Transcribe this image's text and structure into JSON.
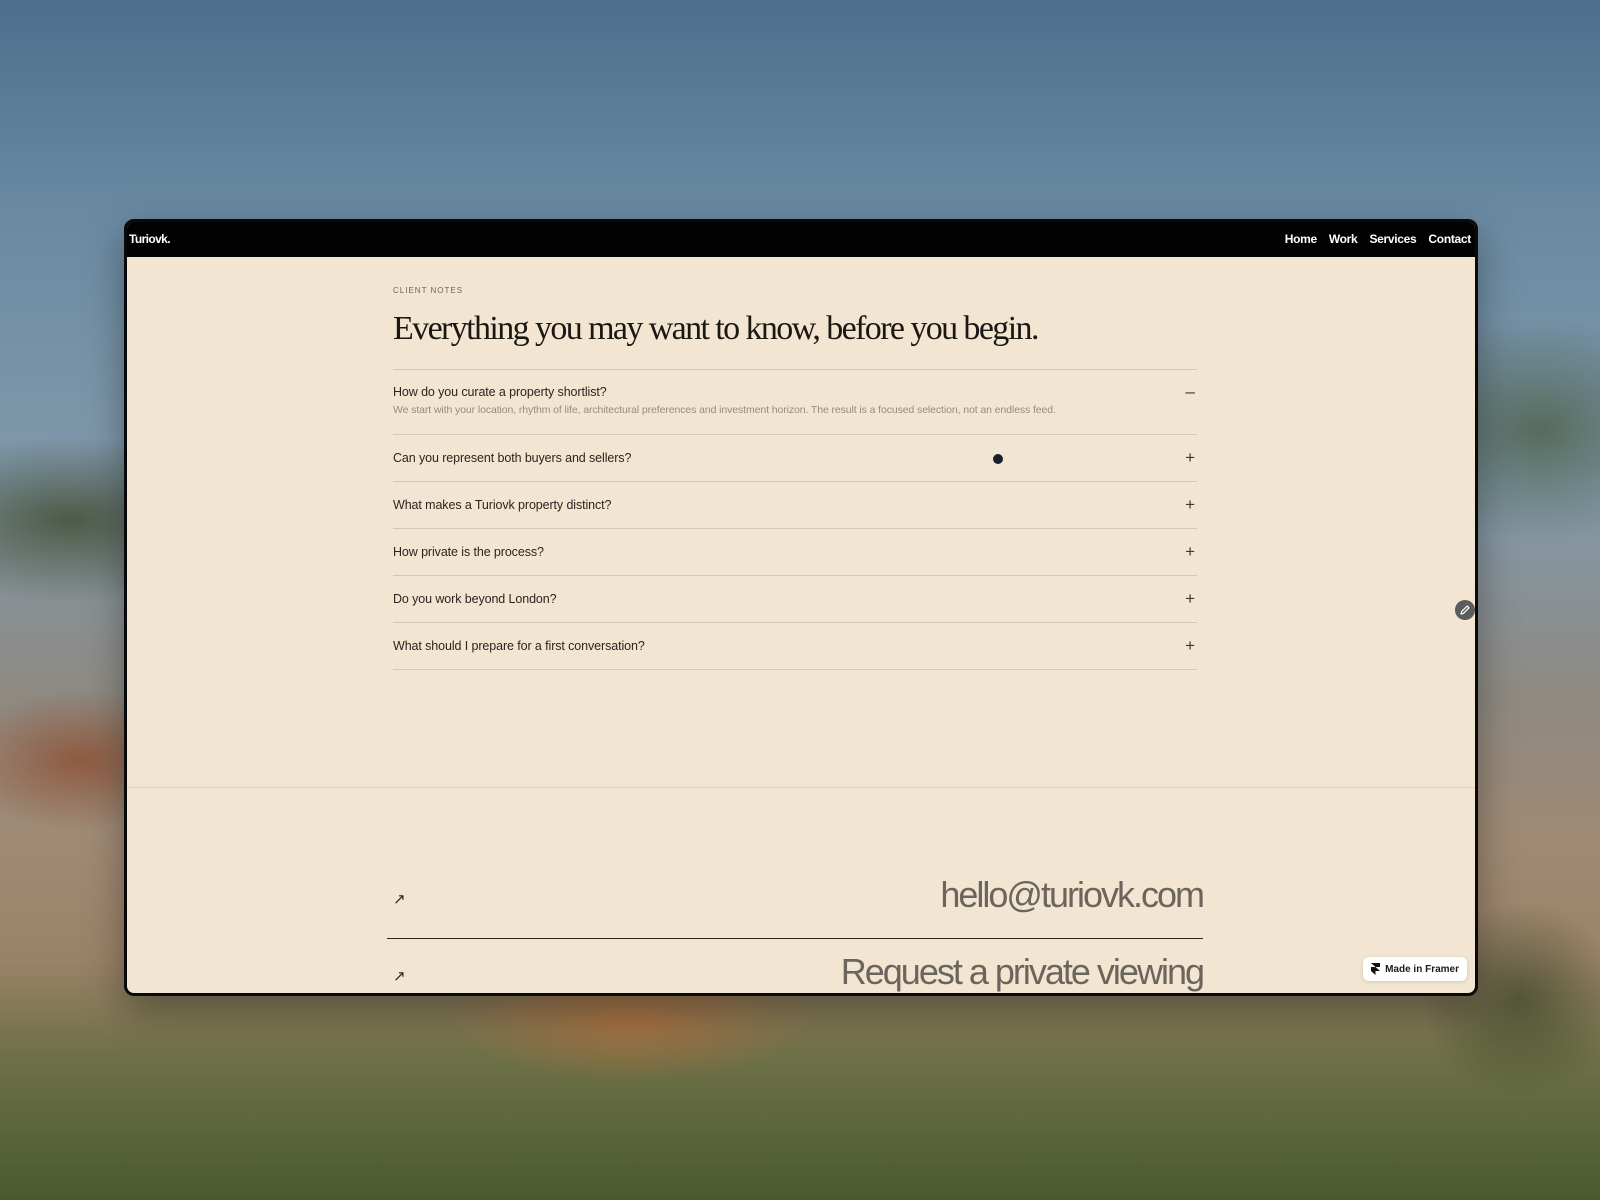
{
  "site": {
    "brand": "Turiovk."
  },
  "nav": {
    "items": [
      "Home",
      "Work",
      "Services",
      "Contact"
    ]
  },
  "faq": {
    "eyebrow": "CLIENT NOTES",
    "headline": "Everything you may want to know, before you begin.",
    "items": [
      {
        "question": "How do you curate a property shortlist?",
        "answer": "We start with your location, rhythm of life, architectural preferences and investment horizon. The result is a focused selection, not an endless feed.",
        "open": true,
        "toggle": "–"
      },
      {
        "question": "Can you represent both buyers and sellers?",
        "open": false,
        "toggle": "+"
      },
      {
        "question": "What makes a Turiovk property distinct?",
        "open": false,
        "toggle": "+"
      },
      {
        "question": "How private is the process?",
        "open": false,
        "toggle": "+"
      },
      {
        "question": "Do you work beyond London?",
        "open": false,
        "toggle": "+"
      },
      {
        "question": "What should I prepare for a first conversation?",
        "open": false,
        "toggle": "+"
      }
    ]
  },
  "contact": {
    "email": "hello@turiovk.com",
    "viewing": "Request a private viewing",
    "arrow_icon": "↗"
  },
  "badge": {
    "label": "Made in Framer"
  },
  "icons": {
    "edit": "pencil-icon"
  }
}
